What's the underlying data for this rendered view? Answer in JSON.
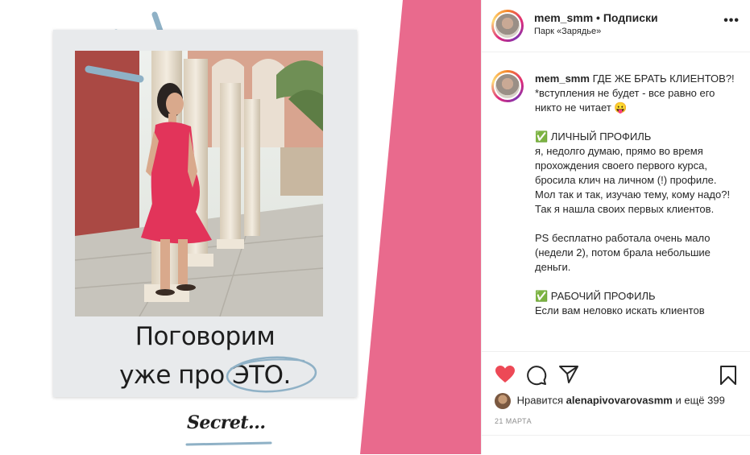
{
  "post_image": {
    "caption_line1": "Поговорим",
    "caption_line2_prefix": "уже про",
    "caption_highlight": "ЭТО.",
    "signature": "Secret..."
  },
  "header": {
    "username": "mem_smm",
    "separator": "•",
    "follow_label": "Подписки",
    "location": "Парк «Зарядье»",
    "more_icon": "more-horizontal-icon"
  },
  "post": {
    "username": "mem_smm",
    "title": "ГДЕ ЖЕ БРАТЬ КЛИЕНТОВ?!",
    "intro": "*вступления не будет - все равно его никто не читает 😛",
    "section1_heading": "✅ ЛИЧНЫЙ ПРОФИЛЬ",
    "section1_body": "я, недолго думаю, прямо во время прохождения своего первого курса, бросила клич на личном (!) профиле. Мол так и так, изучаю тему, кому надо?! Так я нашла своих первых клиентов.",
    "ps_text": "PS бесплатно работала очень мало (недели 2), потом брала небольшие деньги.",
    "section2_heading": "✅ РАБОЧИЙ ПРОФИЛЬ",
    "section2_body": "Если вам неловко искать клиентов"
  },
  "actions": {
    "icons": [
      "heart-icon",
      "comment-icon",
      "share-icon",
      "bookmark-icon"
    ],
    "liked": true,
    "likes_prefix": "Нравится",
    "likes_user": "alenapivovarovasmm",
    "likes_suffix": "и ещё 399",
    "date": "21 МАРТА"
  },
  "colors": {
    "pink_stripe": "#e96a8d",
    "heart": "#ed4956",
    "tape": "#8fb1c6"
  }
}
